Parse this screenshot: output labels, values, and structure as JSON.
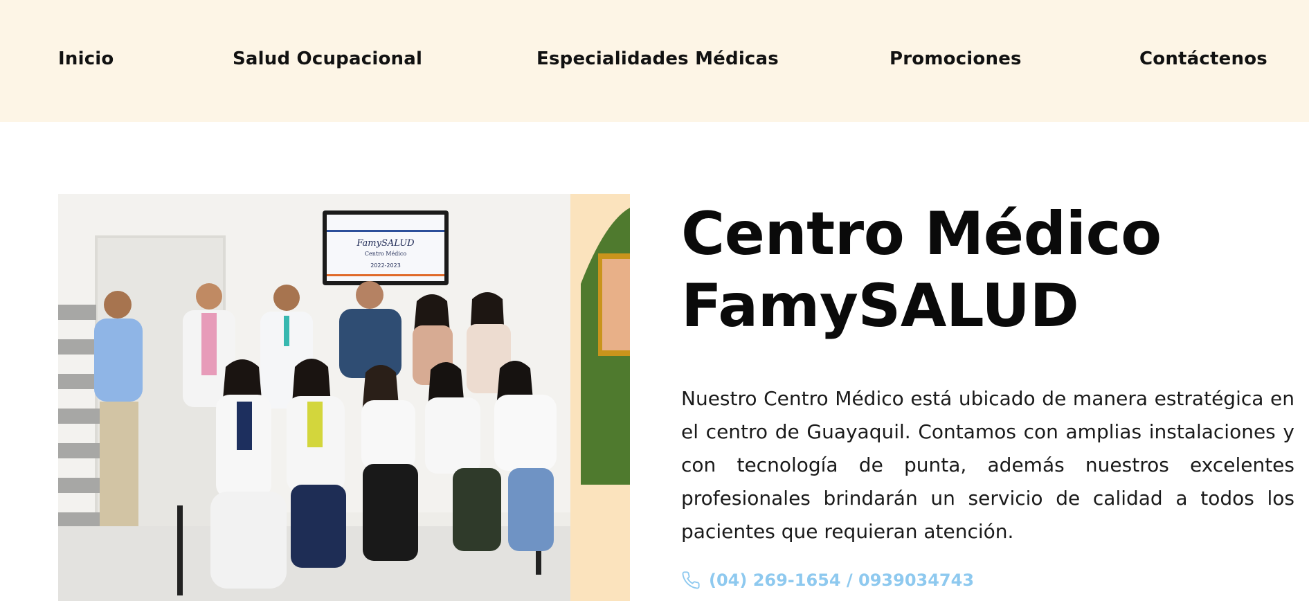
{
  "nav": {
    "items": [
      {
        "label": "Inicio"
      },
      {
        "label": "Salud Ocupacional"
      },
      {
        "label": "Especialidades Médicas"
      },
      {
        "label": "Promociones"
      },
      {
        "label": "Contáctenos"
      }
    ]
  },
  "hero": {
    "title_line1": "Centro Médico",
    "title_line2": "FamySALUD",
    "description": "Nuestro Centro Médico está ubicado de manera estratégica en el centro de Guayaquil. Contamos con amplias instalaciones y con tecnología de punta, además nuestros excelentes profesionales brindarán un servicio de calidad a todos los pacientes que requieran atención.",
    "phone": "(04) 269-1654 / 0939034743",
    "phone_icon": "phone-icon"
  },
  "photo": {
    "tv_title": "FamySALUD",
    "tv_subtitle": "Centro Médico",
    "tv_years": "2022-2023"
  },
  "colors": {
    "nav_background": "#fdf5e6",
    "phone_accent": "#8ec9ef",
    "text": "#111111"
  }
}
